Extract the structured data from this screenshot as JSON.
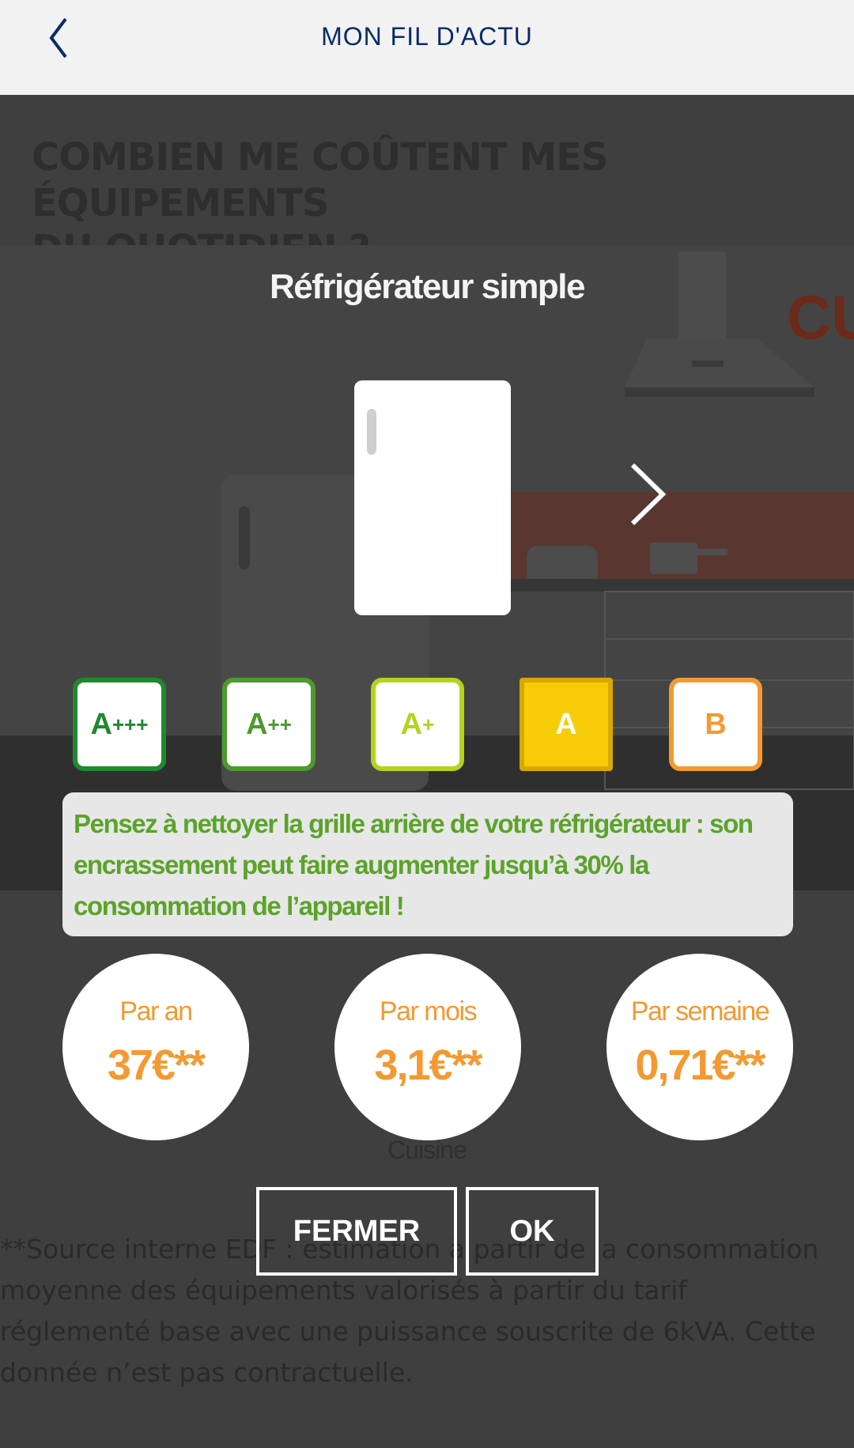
{
  "header": {
    "title": "MON FIL D'ACTU"
  },
  "background": {
    "title_line1": "COMBIEN ME COÛTENT MES ÉQUIPEMENTS",
    "title_line2": "DU QUOTIDIEN ?",
    "sign_text": "CU",
    "room_label": "Cuisine",
    "footnote": "**Source interne EDF : estimation à partir de la consommation moyenne des équipements valorisés à partir du tarif réglementé base avec une puissance souscrite de 6kVA. Cette donnée n’est pas contractuelle."
  },
  "modal": {
    "title": "Réfrigérateur simple",
    "energy_classes": [
      {
        "letter": "A",
        "suffix": "+++",
        "color": "#1e8a2e",
        "selected": false
      },
      {
        "letter": "A",
        "suffix": "++",
        "color": "#4e9a2c",
        "selected": false
      },
      {
        "letter": "A",
        "suffix": "+",
        "color": "#b5d31c",
        "selected": false
      },
      {
        "letter": "A",
        "suffix": "",
        "color": "#f6cc08",
        "selected": true
      },
      {
        "letter": "B",
        "suffix": "",
        "color": "#f29a31",
        "selected": false
      }
    ],
    "tip": "Pensez à nettoyer la grille arrière de votre réfrigérateur : son encrassement peut faire augmenter jusqu’à 30% la consommation de l’appareil !",
    "costs": [
      {
        "label": "Par an",
        "value": "37€**"
      },
      {
        "label": "Par mois",
        "value": "3,1€**"
      },
      {
        "label": "Par semaine",
        "value": "0,71€**"
      }
    ],
    "buttons": {
      "close": "FERMER",
      "ok": "OK"
    }
  },
  "colors": {
    "header_text": "#0a2b66",
    "accent_orange": "#f29a31",
    "tip_green": "#5ba32a"
  }
}
